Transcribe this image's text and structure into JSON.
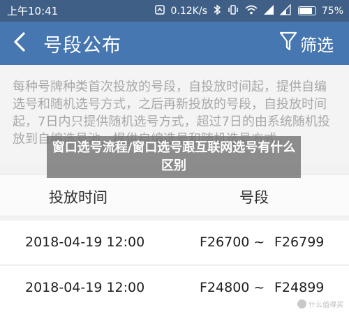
{
  "status_bar": {
    "time": "上午10:41",
    "speed": "0.12K/s",
    "battery": "75%",
    "battery_level": 0.75
  },
  "header": {
    "title": "号段公布",
    "filter_label": "筛选"
  },
  "notice": {
    "text": "每种号牌种类首次投放的号段，自投放时间起，提供自编选号和随机选号方式，之后再新投放的号段，自投放时间起，7日内只提供随机选号方式，超过7日的由系统随机投放到自编选号池，提供自编选号和随机选号方式。"
  },
  "overlay": {
    "text": "窗口选号流程/窗口选号跟互联网选号有什么区别"
  },
  "table": {
    "headers": {
      "time": "投放时间",
      "range": "号段"
    },
    "rows": [
      {
        "time": "2018-04-19 12:00",
        "from": "F26700 ~",
        "to": "F26799"
      },
      {
        "time": "2018-04-19 12:00",
        "from": "F24800 ~",
        "to": "F24899"
      }
    ]
  },
  "watermark": {
    "text": "什么值得买"
  },
  "colors": {
    "status_bar": "#3f5f86",
    "app_bar": "#4777b0",
    "notice_text": "#a8a8a8"
  }
}
